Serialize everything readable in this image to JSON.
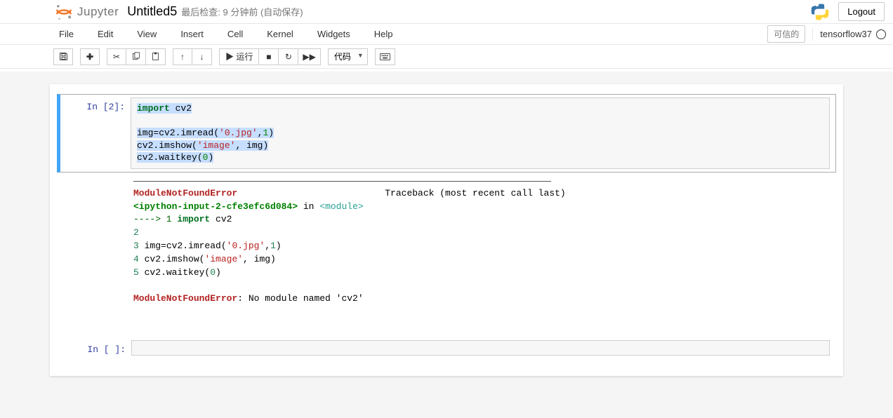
{
  "header": {
    "brand": "Jupyter",
    "notebook_name": "Untitled5",
    "checkpoint": "最后检查: 9 分钟前 (自动保存)",
    "logout": "Logout"
  },
  "menubar": {
    "items": [
      "File",
      "Edit",
      "View",
      "Insert",
      "Cell",
      "Kernel",
      "Widgets",
      "Help"
    ],
    "trusted": "可信的",
    "kernel_name": "tensorflow37"
  },
  "toolbar": {
    "run_label": "▶ 运行",
    "celltype": "代码"
  },
  "cells": {
    "c1": {
      "prompt": "In  [2]:",
      "code": {
        "l1_kw": "import",
        "l1_nm": " cv2",
        "l2": "",
        "l3a": "img=cv2.imread(",
        "l3s": "'0.jpg'",
        "l3b": ",",
        "l3n": "1",
        "l3c": ")",
        "l4a": "cv2.imshow(",
        "l4s": "'image'",
        "l4b": ", img)",
        "l5a": "cv2.waitkey(",
        "l5n": "0",
        "l5b": ")"
      },
      "traceback": {
        "err_name": "ModuleNotFoundError",
        "tb_label": "Traceback (most recent call last)",
        "loc_a": "<ipython-input-2-cfe3efc6d084>",
        "loc_in": " in ",
        "loc_b": "<module>",
        "arrow": "----> 1",
        "l1a": " ",
        "l1kw": "import",
        "l1b": " cv2",
        "n2": "2",
        "n3": "3",
        "l3": " img=cv2.imread(",
        "l3s": "'0.jpg'",
        "l3c": ",",
        "l3n": "1",
        "l3e": ")",
        "n4": "4",
        "l4": " cv2.imshow(",
        "l4s": "'image'",
        "l4b": ", img)",
        "n5": "5",
        "l5": " cv2.waitkey(",
        "l5n": "0",
        "l5e": ")",
        "final_err": "ModuleNotFoundError",
        "final_msg": ": No module named 'cv2'"
      }
    },
    "c2": {
      "prompt": "In  [ ]:"
    }
  }
}
